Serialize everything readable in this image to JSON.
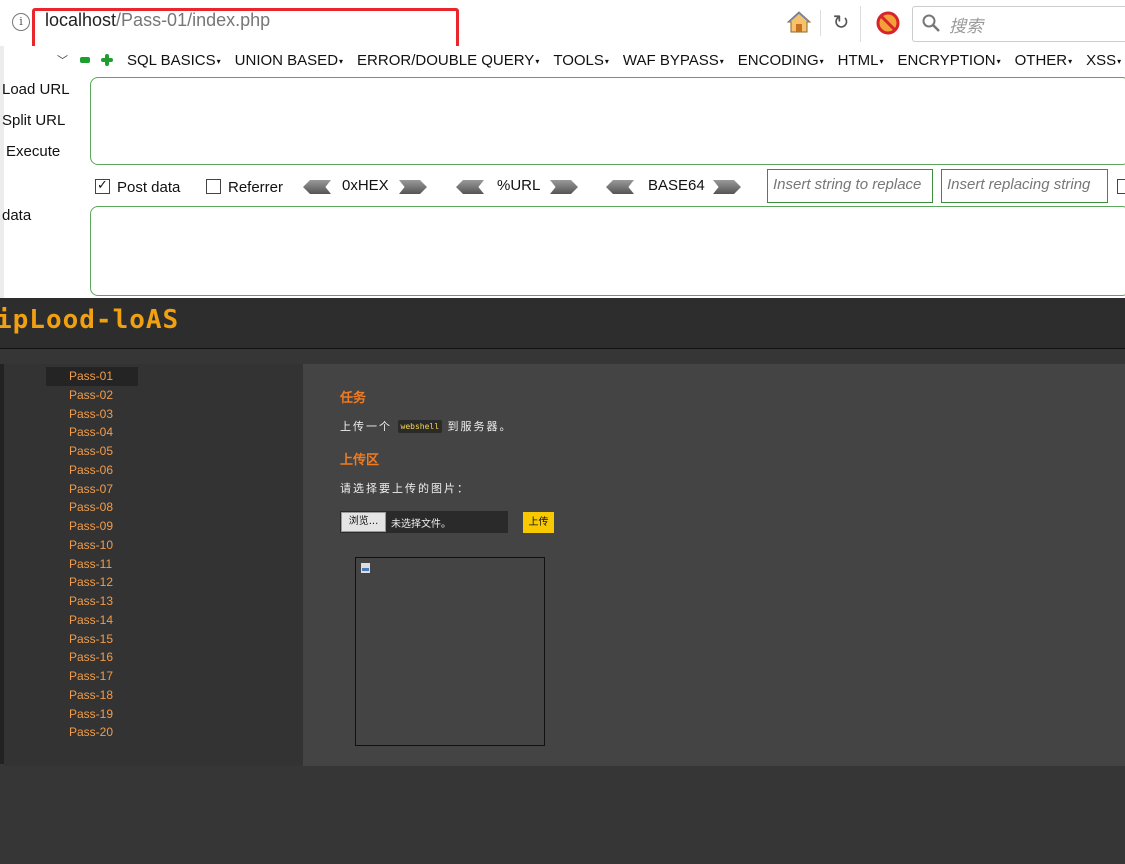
{
  "browser": {
    "address_host": "localhost",
    "address_path": "/Pass-01/index.php",
    "search_placeholder": "搜索"
  },
  "hackbar": {
    "menu": [
      "SQL BASICS",
      "UNION BASED",
      "ERROR/DOUBLE QUERY",
      "TOOLS",
      "WAF BYPASS",
      "ENCODING",
      "HTML",
      "ENCRYPTION",
      "OTHER",
      "XSS"
    ],
    "load_url": "Load URL",
    "split_url": "Split URL",
    "execute": "Execute",
    "data_label": "data",
    "post_data_label": "Post data",
    "post_data_checked": true,
    "referrer_label": "Referrer",
    "referrer_checked": false,
    "encoders": [
      "0xHEX",
      "%URL",
      "BASE64"
    ],
    "replace_placeholder": "Insert string to replace",
    "replacing_placeholder": "Insert replacing string"
  },
  "site": {
    "logo": "ipLood-loAS",
    "nav": [
      "Pass-01",
      "Pass-02",
      "Pass-03",
      "Pass-04",
      "Pass-05",
      "Pass-06",
      "Pass-07",
      "Pass-08",
      "Pass-09",
      "Pass-10",
      "Pass-11",
      "Pass-12",
      "Pass-13",
      "Pass-14",
      "Pass-15",
      "Pass-16",
      "Pass-17",
      "Pass-18",
      "Pass-19",
      "Pass-20"
    ],
    "active_nav": "Pass-01",
    "task_heading": "任务",
    "task_before": "上传一个",
    "task_code": "webshell",
    "task_after": "到服务器。",
    "upload_heading": "上传区",
    "upload_prompt": "请选择要上传的图片：",
    "browse_label": "浏览...",
    "file_status": "未选择文件。",
    "upload_button": "上传"
  },
  "colors": {
    "address_highlight": "#e8262b",
    "nav_link": "#f39c4a",
    "heading": "#f07b20",
    "upload_button": "#f8c800",
    "hackbar_green": "#1e9e2f"
  }
}
